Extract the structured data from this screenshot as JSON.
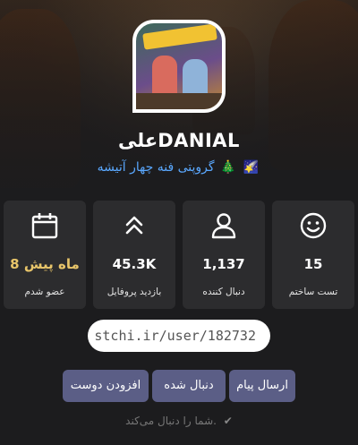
{
  "profile": {
    "username": "علیDANIAL",
    "bio_text": "گروپتی فنه چهار آتیشه",
    "bio_emoji_1": "🎄",
    "bio_emoji_2": "🌠"
  },
  "stats": [
    {
      "value": "15",
      "label": "تست ساختم",
      "icon": "smiley-icon"
    },
    {
      "value": "1,137",
      "label": "دنبال کننده",
      "icon": "user-icon"
    },
    {
      "value": "45.3K",
      "label": "بازدید پروفایل",
      "icon": "double-chevron-up-icon"
    },
    {
      "value": "8 ماه پیش",
      "label": "عضو شدم",
      "icon": "calendar-icon"
    }
  ],
  "profile_link": "stchi.ir/user/182732",
  "actions": {
    "send_message": "ارسال پیام",
    "followed": "دنبال شده",
    "add_friend": "افزودن دوست"
  },
  "follow_note": "شما را دنبال می‌کند.",
  "colors": {
    "background": "#1c1c1e",
    "card": "#2c2c2e",
    "button": "#5b5e86",
    "bio": "#5aa8ff",
    "joined": "#e8c56a"
  }
}
